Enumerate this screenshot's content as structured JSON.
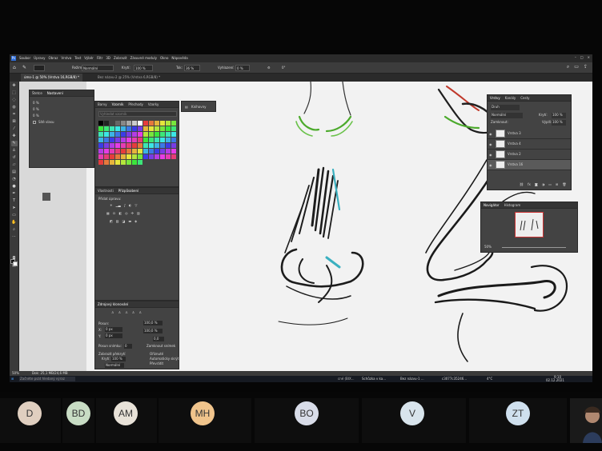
{
  "app": {
    "menu_items": [
      "Soubor",
      "Úpravy",
      "Obraz",
      "Vrstva",
      "Text",
      "Výběr",
      "Filtr",
      "3D",
      "Zobrazit",
      "Zásuvné moduly",
      "Okno",
      "Nápověda"
    ],
    "options": {
      "mode_label": "Režim:",
      "mode_value": "Normální",
      "opacity_label": "Krytí:",
      "opacity_value": "100 %",
      "flow_label": "Tok:",
      "flow_value": "36 %",
      "smooth_label": "Vyhlazení:",
      "smooth_value": "0 %",
      "angle_value": "0°"
    },
    "tabs": [
      {
        "label": "úmo-1 @ 50% (Vrstva 16,RGB/8) *",
        "active": true
      },
      {
        "label": "Bez názvu-2 @ 25% (Vrstva 6,RGB/8) *",
        "active": false
      }
    ],
    "status": {
      "zoom": "50%",
      "doc": "Dok: 25,1 MB/24,6 MB"
    }
  },
  "panels": {
    "brush_settings": {
      "tabs": [
        "Štetce",
        "Nastavení"
      ],
      "rows": [
        "0 %",
        "0 %",
        "0 %"
      ],
      "checkbox": "Sítě vlasu"
    },
    "swatches": {
      "tabs": [
        "Barvy",
        "Vzorník",
        "Přechody",
        "Vzorky"
      ],
      "search_placeholder": "Vyhledat vzorník",
      "colors": [
        "#e63c3c",
        "#e6783c",
        "#e6b43c",
        "#e6e63c",
        "#b4e63c",
        "#78e63c",
        "#3ce63c",
        "#3ce678",
        "#3ce6b4",
        "#3ce6e6",
        "#3cb4e6",
        "#3c78e6",
        "#3c3ce6",
        "#783ce6",
        "#b43ce6",
        "#e63ce6",
        "#e63cb4",
        "#e63c78"
      ]
    },
    "libraries": {
      "tab": "Knihovny"
    },
    "adjustments": {
      "tabs": [
        "Vlastnosti",
        "Přizpůsobení"
      ],
      "label": "Přidat úpravu:"
    },
    "transform": {
      "title": "Zdrojový klonování",
      "offset_label": "Posun:",
      "x_label": "X:",
      "x_value": "0 px",
      "y_label": "Y:",
      "y_value": "0 px",
      "w_value": "100,0 %",
      "h_value": "100,0 %",
      "angle_value": "0,0",
      "frame_label": "Posun snímku:",
      "frame_value": "0",
      "lock_label": "Zamknout snímek",
      "show_overlay": "Zobrazit překrytí",
      "opacity_label": "Krytí:",
      "opacity_value": "100 %",
      "clipped": "Oříznuté",
      "autohide": "Automaticky skrýt",
      "invert": "Převrátit",
      "mode": "Normální"
    },
    "layers": {
      "tabs": [
        "Vrstvy",
        "Kanály",
        "Cesty"
      ],
      "kind_label": "Druh",
      "blend": "Normální",
      "opacity_label": "Krytí:",
      "opacity": "100 %",
      "lock_label": "Zamknout:",
      "fill_label": "Výplň:",
      "fill": "100 %",
      "items": [
        "Vrstva 3",
        "Vrstva 4",
        "Vrstva 2",
        "Vrstva 16"
      ]
    },
    "navigator": {
      "tabs": [
        "Navigátor",
        "Histogram"
      ],
      "zoom": "50%"
    }
  },
  "taskbar": {
    "search_placeholder": "Začněte psát hledaný výraz",
    "items": [
      "Schůzka v ka...",
      "Bez názvu-1 ...",
      "c3077c35246..."
    ],
    "partial_label": "cné (BIX...",
    "weather": "4°C",
    "time": "9:10",
    "date": "02.12.2021"
  },
  "participants": [
    {
      "initials": "D",
      "color": "#e0cfc0"
    },
    {
      "initials": "BD",
      "color": "#c8dcc4"
    },
    {
      "initials": "AM",
      "color": "#e8e2d8"
    },
    {
      "initials": "MH",
      "color": "#f0c48c"
    },
    {
      "initials": "BO",
      "color": "#d8dce8"
    },
    {
      "initials": "V",
      "color": "#d8e4ec"
    },
    {
      "initials": "ZT",
      "color": "#cfe0ee"
    }
  ]
}
